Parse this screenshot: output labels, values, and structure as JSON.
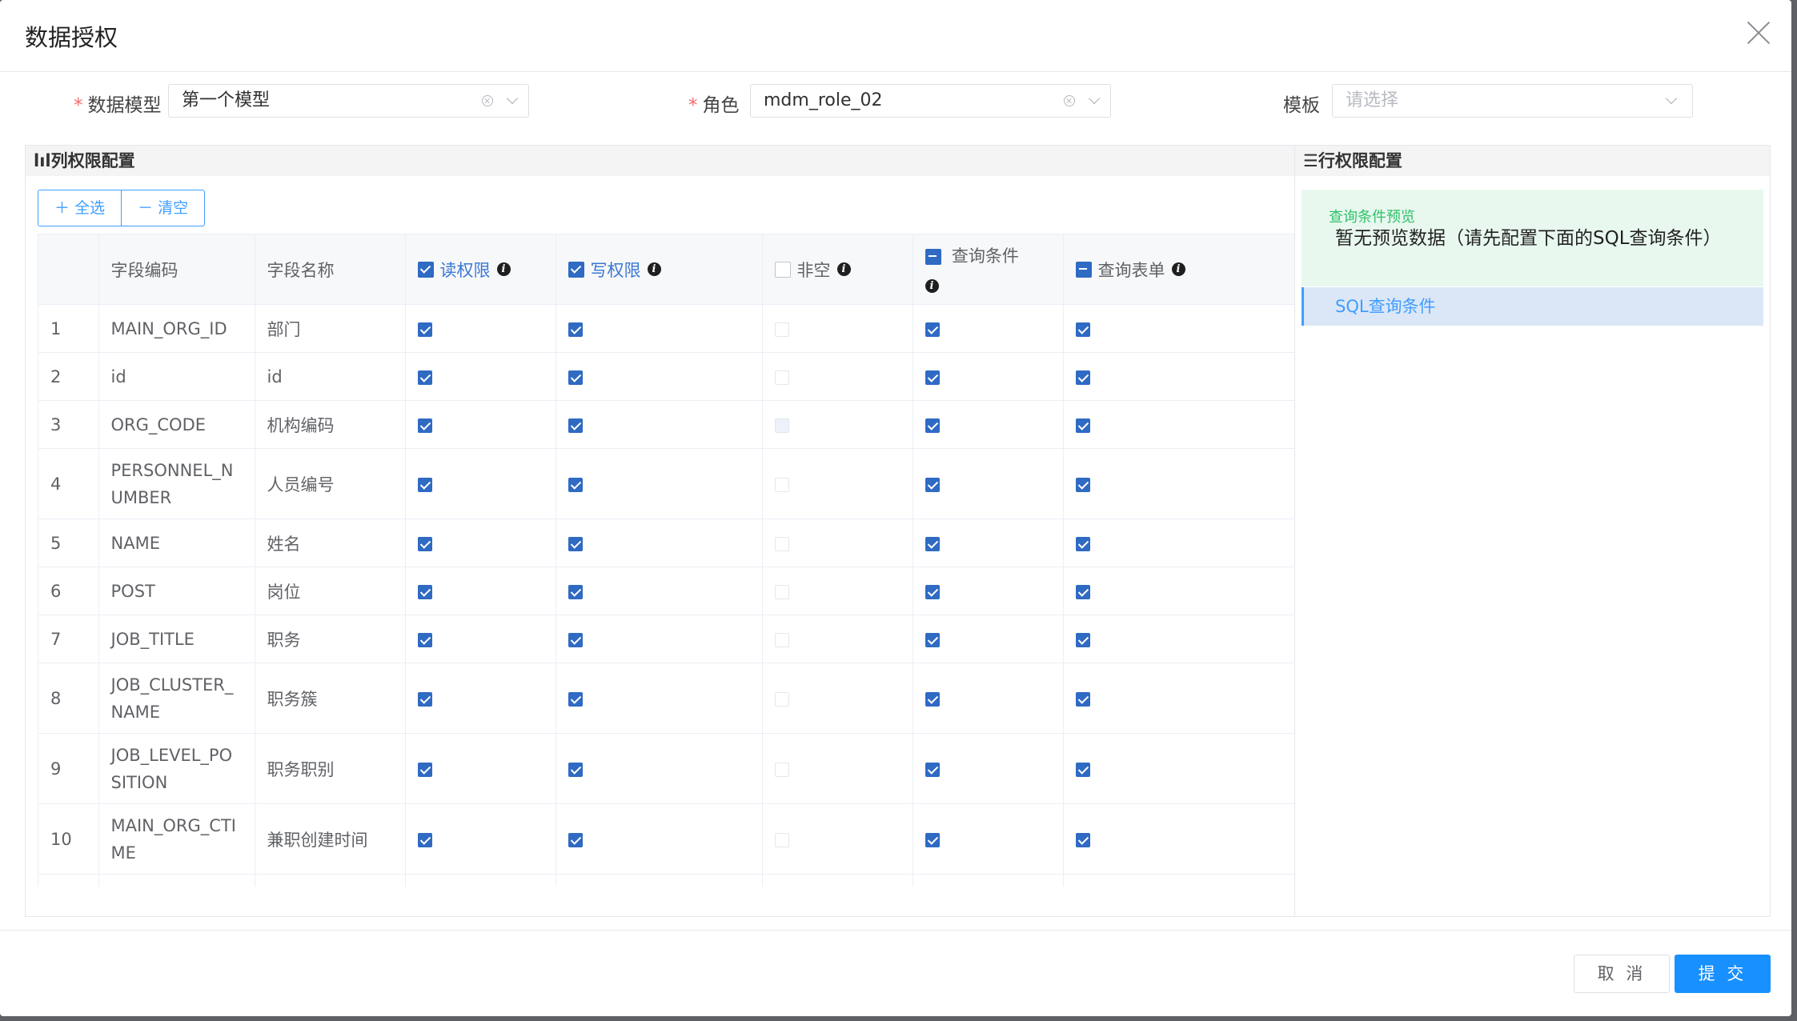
{
  "dialog": {
    "title": "数据授权"
  },
  "form": {
    "model": {
      "label": "数据模型",
      "value": "第一个模型"
    },
    "role": {
      "label": "角色",
      "value": "mdm_role_02"
    },
    "template": {
      "label": "模板",
      "placeholder": "请选择"
    }
  },
  "column_panel": {
    "title": "列权限配置",
    "select_all": "全选",
    "clear": "清空",
    "headers": {
      "index": "",
      "code": "字段编码",
      "name": "字段名称",
      "read": "读权限",
      "write": "写权限",
      "required": "非空",
      "query": "查询条件",
      "query_form": "查询表单"
    },
    "header_checkbox_state": {
      "read": "checked",
      "write": "checked",
      "required": "unchecked",
      "query": "indeterminate",
      "query_form": "indeterminate"
    },
    "rows": [
      {
        "index": "1",
        "code": "MAIN_ORG_ID",
        "name": "部门",
        "read": true,
        "write": true,
        "required": false,
        "query": true,
        "query_form": true
      },
      {
        "index": "2",
        "code": "id",
        "name": "id",
        "read": true,
        "write": true,
        "required": false,
        "query": true,
        "query_form": true
      },
      {
        "index": "3",
        "code": "ORG_CODE",
        "name": "机构编码",
        "read": true,
        "write": true,
        "required": false,
        "query": true,
        "query_form": true
      },
      {
        "index": "4",
        "code": "PERSONNEL_NUMBER",
        "name": "人员编号",
        "read": true,
        "write": true,
        "required": false,
        "query": true,
        "query_form": true
      },
      {
        "index": "5",
        "code": "NAME",
        "name": "姓名",
        "read": true,
        "write": true,
        "required": false,
        "query": true,
        "query_form": true
      },
      {
        "index": "6",
        "code": "POST",
        "name": "岗位",
        "read": true,
        "write": true,
        "required": false,
        "query": true,
        "query_form": true
      },
      {
        "index": "7",
        "code": "JOB_TITLE",
        "name": "职务",
        "read": true,
        "write": true,
        "required": false,
        "query": true,
        "query_form": true
      },
      {
        "index": "8",
        "code": "JOB_CLUSTER_NAME",
        "name": "职务簇",
        "read": true,
        "write": true,
        "required": false,
        "query": true,
        "query_form": true
      },
      {
        "index": "9",
        "code": "JOB_LEVEL_POSITION",
        "name": "职务职别",
        "read": true,
        "write": true,
        "required": false,
        "query": true,
        "query_form": true
      },
      {
        "index": "10",
        "code": "MAIN_ORG_CTIME",
        "name": "兼职创建时间",
        "read": true,
        "write": true,
        "required": false,
        "query": true,
        "query_form": true
      }
    ]
  },
  "row_panel": {
    "title": "行权限配置",
    "preview_label": "查询条件预览",
    "preview_text": "暂无预览数据（请先配置下面的SQL查询条件）",
    "sql_item": "SQL查询条件"
  },
  "footer": {
    "cancel": "取 消",
    "submit": "提 交"
  },
  "colors": {
    "primary": "#1890ff",
    "checkbox": "#2f6ac3",
    "preview_bg": "#e8f8ef",
    "preview_label": "#2fc26a"
  }
}
